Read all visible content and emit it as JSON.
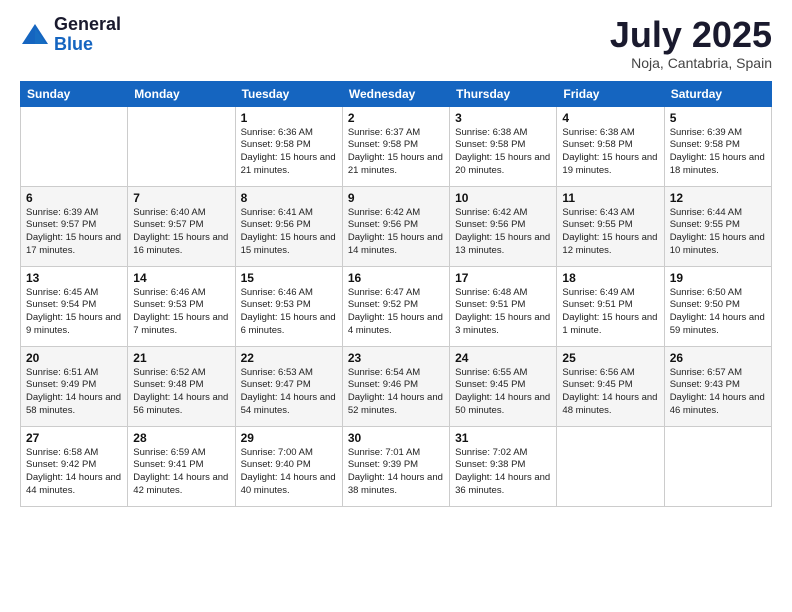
{
  "logo": {
    "general": "General",
    "blue": "Blue"
  },
  "title": "July 2025",
  "location": "Noja, Cantabria, Spain",
  "days_of_week": [
    "Sunday",
    "Monday",
    "Tuesday",
    "Wednesday",
    "Thursday",
    "Friday",
    "Saturday"
  ],
  "weeks": [
    [
      {
        "day": "",
        "info": ""
      },
      {
        "day": "",
        "info": ""
      },
      {
        "day": "1",
        "info": "Sunrise: 6:36 AM\nSunset: 9:58 PM\nDaylight: 15 hours and 21 minutes."
      },
      {
        "day": "2",
        "info": "Sunrise: 6:37 AM\nSunset: 9:58 PM\nDaylight: 15 hours and 21 minutes."
      },
      {
        "day": "3",
        "info": "Sunrise: 6:38 AM\nSunset: 9:58 PM\nDaylight: 15 hours and 20 minutes."
      },
      {
        "day": "4",
        "info": "Sunrise: 6:38 AM\nSunset: 9:58 PM\nDaylight: 15 hours and 19 minutes."
      },
      {
        "day": "5",
        "info": "Sunrise: 6:39 AM\nSunset: 9:58 PM\nDaylight: 15 hours and 18 minutes."
      }
    ],
    [
      {
        "day": "6",
        "info": "Sunrise: 6:39 AM\nSunset: 9:57 PM\nDaylight: 15 hours and 17 minutes."
      },
      {
        "day": "7",
        "info": "Sunrise: 6:40 AM\nSunset: 9:57 PM\nDaylight: 15 hours and 16 minutes."
      },
      {
        "day": "8",
        "info": "Sunrise: 6:41 AM\nSunset: 9:56 PM\nDaylight: 15 hours and 15 minutes."
      },
      {
        "day": "9",
        "info": "Sunrise: 6:42 AM\nSunset: 9:56 PM\nDaylight: 15 hours and 14 minutes."
      },
      {
        "day": "10",
        "info": "Sunrise: 6:42 AM\nSunset: 9:56 PM\nDaylight: 15 hours and 13 minutes."
      },
      {
        "day": "11",
        "info": "Sunrise: 6:43 AM\nSunset: 9:55 PM\nDaylight: 15 hours and 12 minutes."
      },
      {
        "day": "12",
        "info": "Sunrise: 6:44 AM\nSunset: 9:55 PM\nDaylight: 15 hours and 10 minutes."
      }
    ],
    [
      {
        "day": "13",
        "info": "Sunrise: 6:45 AM\nSunset: 9:54 PM\nDaylight: 15 hours and 9 minutes."
      },
      {
        "day": "14",
        "info": "Sunrise: 6:46 AM\nSunset: 9:53 PM\nDaylight: 15 hours and 7 minutes."
      },
      {
        "day": "15",
        "info": "Sunrise: 6:46 AM\nSunset: 9:53 PM\nDaylight: 15 hours and 6 minutes."
      },
      {
        "day": "16",
        "info": "Sunrise: 6:47 AM\nSunset: 9:52 PM\nDaylight: 15 hours and 4 minutes."
      },
      {
        "day": "17",
        "info": "Sunrise: 6:48 AM\nSunset: 9:51 PM\nDaylight: 15 hours and 3 minutes."
      },
      {
        "day": "18",
        "info": "Sunrise: 6:49 AM\nSunset: 9:51 PM\nDaylight: 15 hours and 1 minute."
      },
      {
        "day": "19",
        "info": "Sunrise: 6:50 AM\nSunset: 9:50 PM\nDaylight: 14 hours and 59 minutes."
      }
    ],
    [
      {
        "day": "20",
        "info": "Sunrise: 6:51 AM\nSunset: 9:49 PM\nDaylight: 14 hours and 58 minutes."
      },
      {
        "day": "21",
        "info": "Sunrise: 6:52 AM\nSunset: 9:48 PM\nDaylight: 14 hours and 56 minutes."
      },
      {
        "day": "22",
        "info": "Sunrise: 6:53 AM\nSunset: 9:47 PM\nDaylight: 14 hours and 54 minutes."
      },
      {
        "day": "23",
        "info": "Sunrise: 6:54 AM\nSunset: 9:46 PM\nDaylight: 14 hours and 52 minutes."
      },
      {
        "day": "24",
        "info": "Sunrise: 6:55 AM\nSunset: 9:45 PM\nDaylight: 14 hours and 50 minutes."
      },
      {
        "day": "25",
        "info": "Sunrise: 6:56 AM\nSunset: 9:45 PM\nDaylight: 14 hours and 48 minutes."
      },
      {
        "day": "26",
        "info": "Sunrise: 6:57 AM\nSunset: 9:43 PM\nDaylight: 14 hours and 46 minutes."
      }
    ],
    [
      {
        "day": "27",
        "info": "Sunrise: 6:58 AM\nSunset: 9:42 PM\nDaylight: 14 hours and 44 minutes."
      },
      {
        "day": "28",
        "info": "Sunrise: 6:59 AM\nSunset: 9:41 PM\nDaylight: 14 hours and 42 minutes."
      },
      {
        "day": "29",
        "info": "Sunrise: 7:00 AM\nSunset: 9:40 PM\nDaylight: 14 hours and 40 minutes."
      },
      {
        "day": "30",
        "info": "Sunrise: 7:01 AM\nSunset: 9:39 PM\nDaylight: 14 hours and 38 minutes."
      },
      {
        "day": "31",
        "info": "Sunrise: 7:02 AM\nSunset: 9:38 PM\nDaylight: 14 hours and 36 minutes."
      },
      {
        "day": "",
        "info": ""
      },
      {
        "day": "",
        "info": ""
      }
    ]
  ]
}
